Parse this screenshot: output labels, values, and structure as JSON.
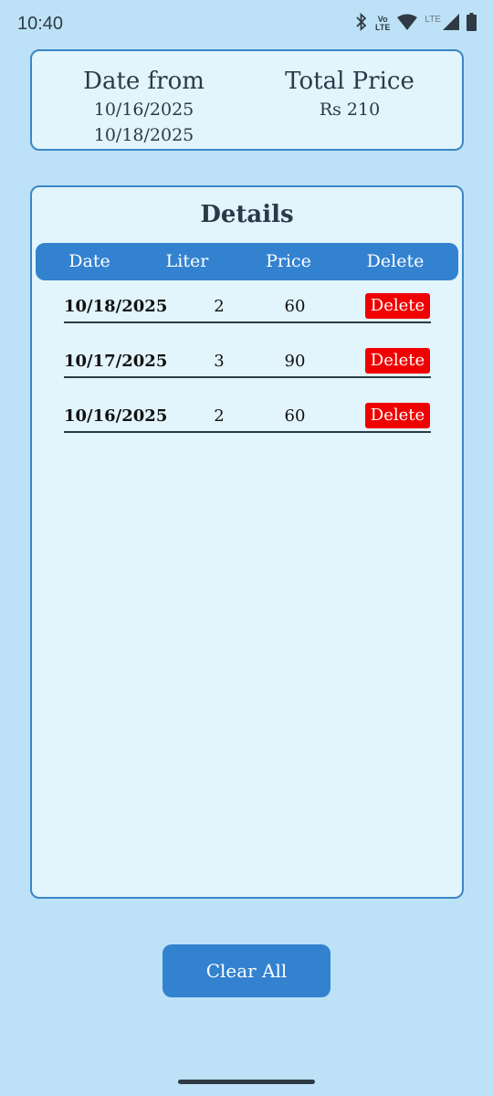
{
  "status": {
    "time": "10:40",
    "volte_top": "Vo",
    "volte_bottom": "LTE",
    "lte": "LTE"
  },
  "summary": {
    "date_title": "Date from",
    "date_from": "10/16/2025",
    "date_to": "10/18/2025",
    "price_title": "Total Price",
    "total_price": "Rs 210"
  },
  "details": {
    "title": "Details",
    "headers": {
      "date": "Date",
      "liter": "Liter",
      "price": "Price",
      "delete": "Delete"
    },
    "rows": [
      {
        "date": "10/18/2025",
        "liter": "2",
        "price": "60",
        "delete_label": "Delete"
      },
      {
        "date": "10/17/2025",
        "liter": "3",
        "price": "90",
        "delete_label": "Delete"
      },
      {
        "date": "10/16/2025",
        "liter": "2",
        "price": "60",
        "delete_label": "Delete"
      }
    ]
  },
  "actions": {
    "clear_all": "Clear All"
  },
  "colors": {
    "background": "#bde2f7",
    "card": "#e2f4fc",
    "accent": "#3382d0",
    "delete": "#f00000"
  },
  "icons": [
    "bluetooth-icon",
    "wifi-icon",
    "signal-icon",
    "battery-icon"
  ]
}
